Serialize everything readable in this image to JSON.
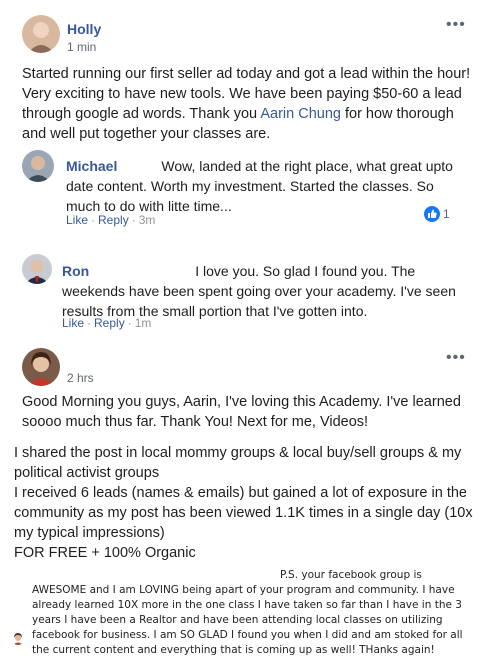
{
  "post1": {
    "author": "Holly",
    "time": "1 min",
    "text_before": "Started running our first seller ad today and got a lead within the hour! Very exciting to have new tools. We have been paying $50-60 a lead through google ad words. Thank you ",
    "tag": "Aarin Chung",
    "text_after": " for how thorough and well put together your classes are."
  },
  "comment1": {
    "author": "Michael",
    "text": "Wow, landed at the right place, what great upto date content. Worth my investment. Started the classes. So much to do with litte time...",
    "like": "Like",
    "reply": "Reply",
    "time": "3m",
    "reaction_count": "1"
  },
  "comment2": {
    "author": "Ron",
    "text": "I love you. So glad I found you. The weekends have been spent going over your academy. I've seen results from the small portion that I've gotten into.",
    "like": "Like",
    "reply": "Reply",
    "time": "1m"
  },
  "post2": {
    "time": "2 hrs",
    "para1": "Good Morning you guys, Aarin, I've loving this Academy. I've learned soooo much thus far. Thank You! Next for me, Videos!",
    "line1": "I shared the post in local mommy groups & local buy/sell groups & my political activist groups",
    "line2": "I received 6 leads (names & emails) but gained a lot of exposure in the community as my post has been viewed 1.1K times in a single day (10x my typical impressions)",
    "line3": "FOR FREE + 100% Organic"
  },
  "testimonial": {
    "text": "P.S. your facebook group is AWESOME and I am LOVING being apart of your program and community. I have already learned 10X more in the one class I have taken so far than I have in the 3 years I have been a Realtor and have been attending local classes on utilizing facebook for business. I am SO GLAD I found you when I did and am stoked for all the current content and everything that is coming up as well! THanks again!"
  },
  "icons": {
    "more": "more-options-icon",
    "like": "thumbs-up-icon"
  },
  "colors": {
    "link": "#385898",
    "like_blue": "#1877f2",
    "meta_gray": "#616770"
  }
}
